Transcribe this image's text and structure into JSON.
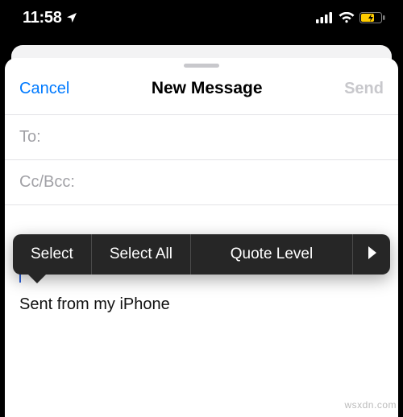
{
  "status": {
    "time": "11:58",
    "location_icon": "location-arrow",
    "signal": "signal-icon",
    "wifi": "wifi-icon",
    "battery": "battery-charging-icon"
  },
  "nav": {
    "cancel": "Cancel",
    "title": "New Message",
    "send": "Send"
  },
  "fields": {
    "to_label": "To:",
    "ccbcc_label": "Cc/Bcc:"
  },
  "body": {
    "signature": "Sent from my iPhone"
  },
  "menu": {
    "select": "Select",
    "select_all": "Select All",
    "quote_level": "Quote Level",
    "more_icon": "chevron-right-icon"
  },
  "watermark": "wsxdn.com",
  "colors": {
    "ios_blue": "#007aff",
    "menu_bg": "#262626",
    "battery_fill": "#ffcc00"
  }
}
